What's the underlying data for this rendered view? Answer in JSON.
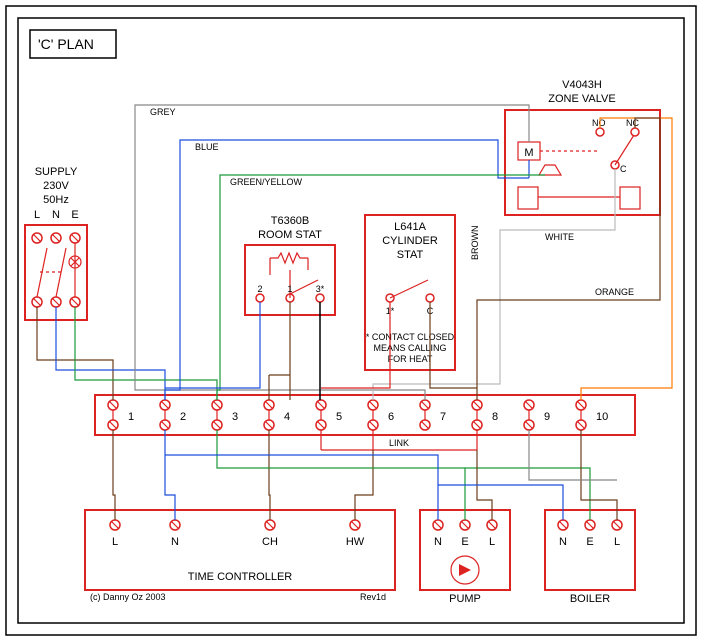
{
  "title": "'C' PLAN",
  "supply": {
    "label": "SUPPLY",
    "voltage": "230V",
    "freq": "50Hz",
    "terminals": [
      "L",
      "N",
      "E"
    ]
  },
  "room_stat": {
    "model": "T6360B",
    "label": "ROOM STAT",
    "terminals": [
      "2",
      "1",
      "3*"
    ]
  },
  "cylinder_stat": {
    "model": "L641A",
    "label": "CYLINDER",
    "label2": "STAT",
    "terminals": [
      "1*",
      "C"
    ],
    "footnote1": "* CONTACT CLOSED",
    "footnote2": "MEANS CALLING",
    "footnote3": "FOR HEAT"
  },
  "zone_valve": {
    "model": "V4043H",
    "label": "ZONE VALVE",
    "labels": {
      "m": "M",
      "no": "NO",
      "nc": "NC",
      "c": "C"
    }
  },
  "bus": {
    "link_label": "LINK",
    "terms": [
      "1",
      "2",
      "3",
      "4",
      "5",
      "6",
      "7",
      "8",
      "9",
      "10"
    ]
  },
  "time_controller": {
    "label": "TIME CONTROLLER",
    "terms": [
      "L",
      "N",
      "CH",
      "HW"
    ],
    "credit": "(c) Danny Oz 2003",
    "rev": "Rev1d"
  },
  "pump": {
    "label": "PUMP",
    "terms": [
      "N",
      "E",
      "L"
    ]
  },
  "boiler": {
    "label": "BOILER",
    "terms": [
      "N",
      "E",
      "L"
    ]
  },
  "wire_colors": {
    "grey": "GREY",
    "blue": "BLUE",
    "green": "GREEN/YELLOW",
    "brown": "BROWN",
    "white": "WHITE",
    "orange": "ORANGE"
  }
}
